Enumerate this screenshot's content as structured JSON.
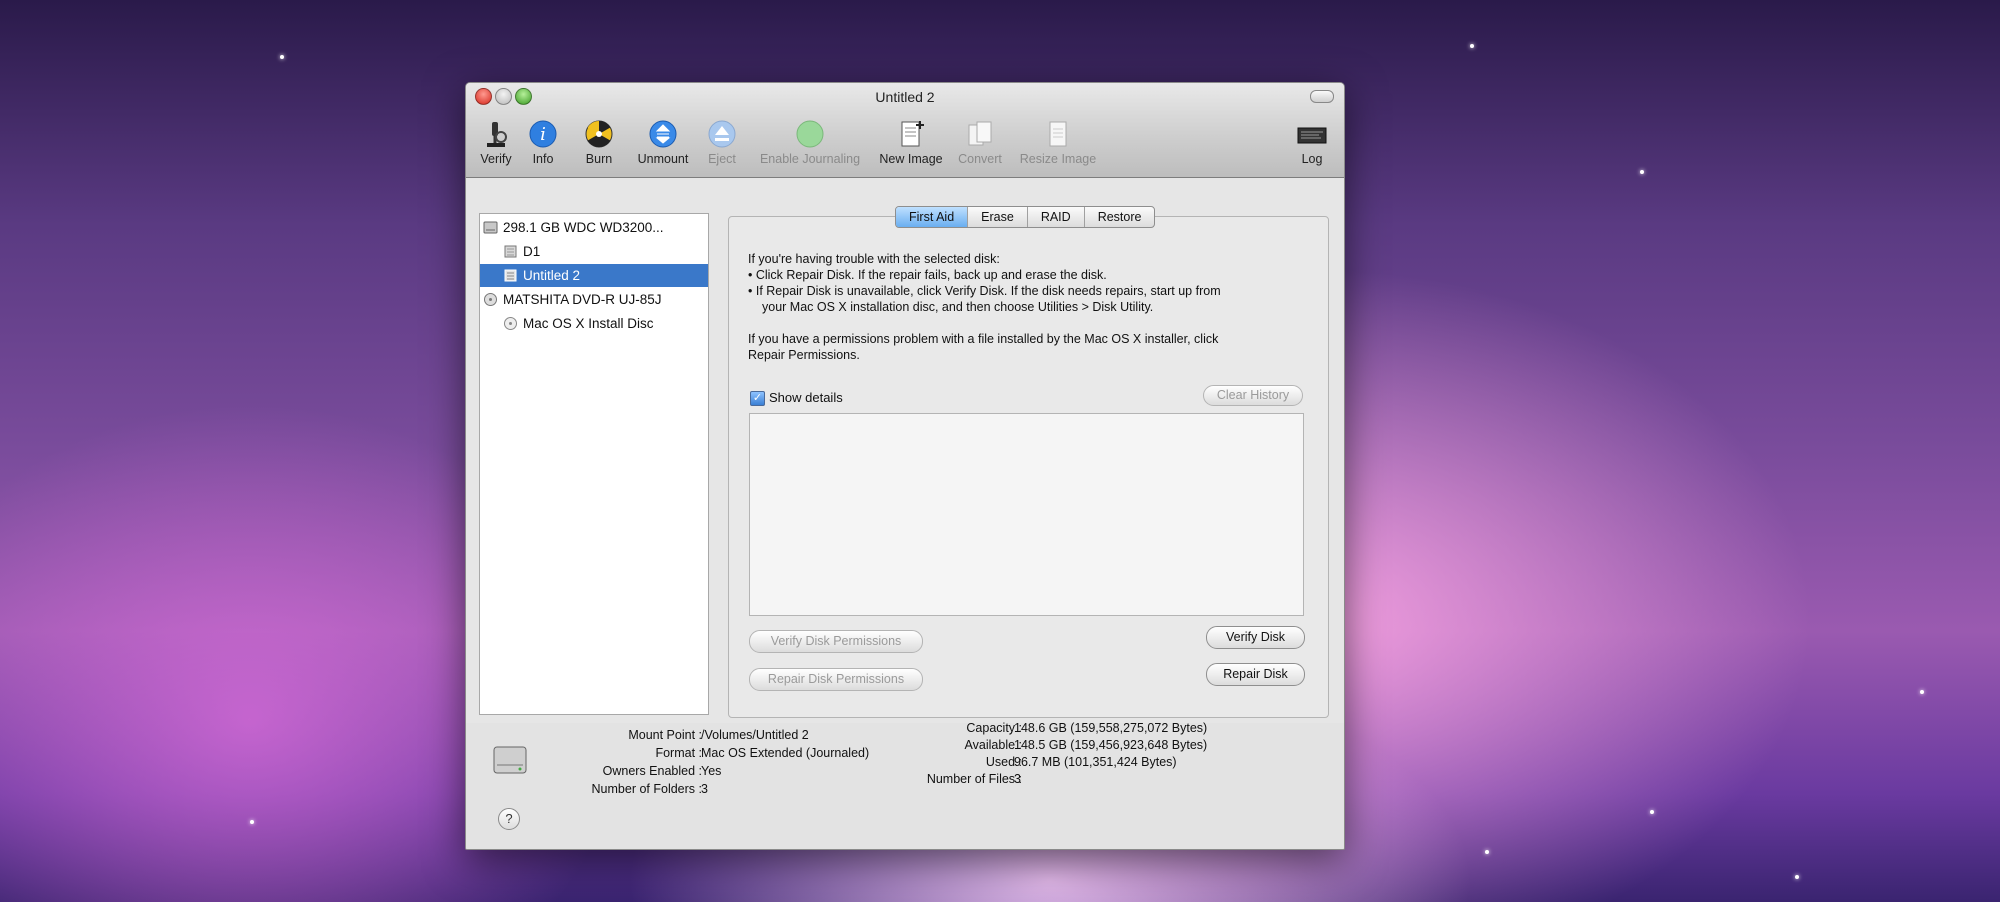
{
  "window": {
    "title": "Untitled 2"
  },
  "toolbar": {
    "items": [
      {
        "label": "Verify",
        "icon": "microscope-icon",
        "enabled": true
      },
      {
        "label": "Info",
        "icon": "info-icon",
        "enabled": true
      },
      {
        "label": "Burn",
        "icon": "burn-icon",
        "enabled": true
      },
      {
        "label": "Unmount",
        "icon": "unmount-icon",
        "enabled": true
      },
      {
        "label": "Eject",
        "icon": "eject-icon",
        "enabled": false
      },
      {
        "label": "Enable Journaling",
        "icon": "journaling-icon",
        "enabled": false
      },
      {
        "label": "New Image",
        "icon": "new-image-icon",
        "enabled": true
      },
      {
        "label": "Convert",
        "icon": "convert-icon",
        "enabled": false
      },
      {
        "label": "Resize Image",
        "icon": "resize-image-icon",
        "enabled": false
      },
      {
        "label": "Log",
        "icon": "log-icon",
        "enabled": true
      }
    ]
  },
  "sidebar": {
    "items": [
      {
        "label": "298.1 GB WDC WD3200...",
        "level": 0,
        "icon": "hard-disk-icon"
      },
      {
        "label": "D1",
        "level": 1,
        "icon": "volume-icon"
      },
      {
        "label": "Untitled 2",
        "level": 1,
        "icon": "volume-icon",
        "selected": true
      },
      {
        "label": "MATSHITA DVD-R UJ-85J",
        "level": 0,
        "icon": "optical-drive-icon"
      },
      {
        "label": "Mac OS X Install Disc",
        "level": 1,
        "icon": "disc-icon"
      }
    ]
  },
  "tabs": [
    "First Aid",
    "Erase",
    "RAID",
    "Restore"
  ],
  "first_aid": {
    "line1": "If you're having trouble with the selected disk:",
    "line2": "• Click Repair Disk. If the repair fails, back up and erase the disk.",
    "line3": "• If Repair Disk is unavailable, click Verify Disk. If the disk needs repairs, start up from",
    "line4": "your Mac OS X installation disc, and then choose Utilities > Disk Utility.",
    "line5": "If you have a permissions problem with a file installed by the Mac OS X installer, click",
    "line6": "Repair Permissions.",
    "show_details_label": "Show details",
    "show_details_checked": true,
    "clear_history_label": "Clear History",
    "verify_permissions_label": "Verify Disk Permissions",
    "repair_permissions_label": "Repair Disk Permissions",
    "verify_disk_label": "Verify Disk",
    "repair_disk_label": "Repair Disk"
  },
  "info": {
    "mount_point_label": "Mount Point :",
    "mount_point": "/Volumes/Untitled 2",
    "format_label": "Format :",
    "format": "Mac OS Extended (Journaled)",
    "owners_label": "Owners Enabled :",
    "owners": "Yes",
    "folders_label": "Number of Folders :",
    "folders": "3",
    "capacity_label": "Capacity :",
    "capacity": "148.6 GB (159,558,275,072 Bytes)",
    "available_label": "Available :",
    "available": "148.5 GB (159,456,923,648 Bytes)",
    "used_label": "Used :",
    "used": "96.7 MB (101,351,424 Bytes)",
    "files_label": "Number of Files :",
    "files": "3"
  },
  "help_label": "?",
  "colors": {
    "selection": "#3a78c9",
    "active_tab": "#6aaef0"
  }
}
